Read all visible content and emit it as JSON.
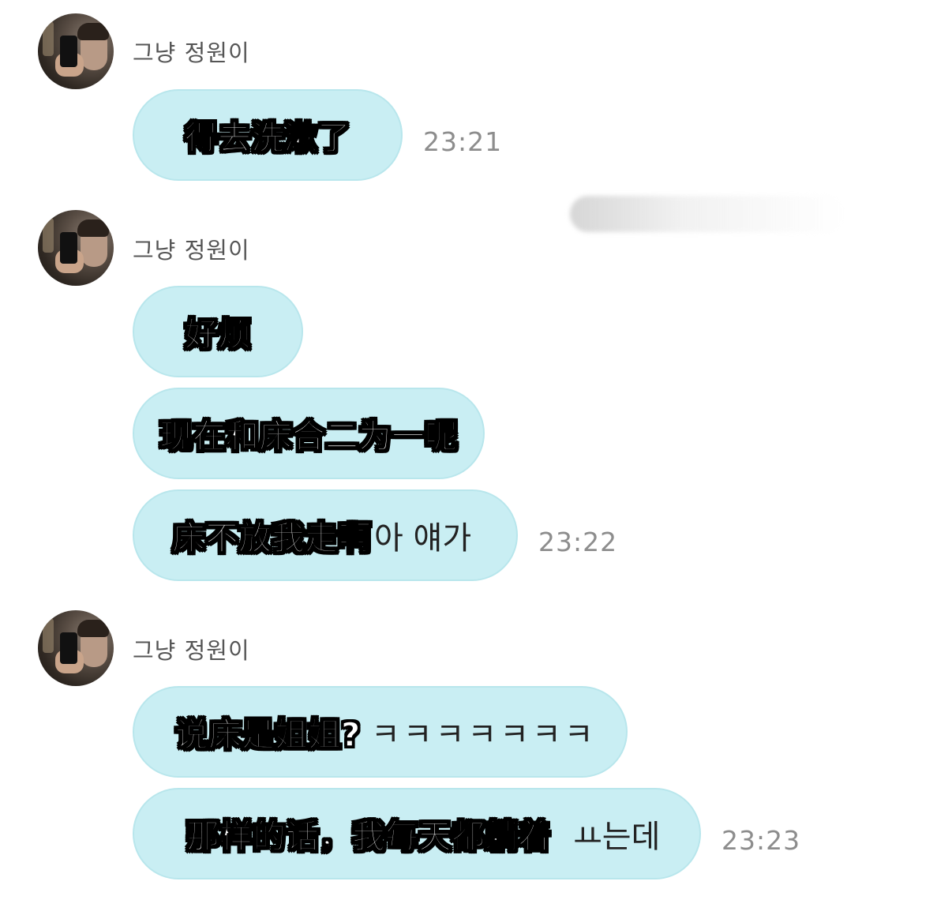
{
  "messages": [
    {
      "sender": "그냥 정원이",
      "bubbles": [
        {
          "ko": "",
          "cn": "得去洗漱了",
          "time": "23:21"
        }
      ]
    },
    {
      "sender": "그냥 정원이",
      "bubbles": [
        {
          "ko": "",
          "cn": "好烦",
          "time": ""
        },
        {
          "ko": "",
          "cn": "现在和床合二为一呢",
          "time": ""
        },
        {
          "ko": "아 얘가",
          "cn": "床不放我走啊",
          "time": "23:22"
        }
      ]
    },
    {
      "sender": "그냥 정원이",
      "bubbles": [
        {
          "ko": "ㅋㅋㅋㅋㅋㅋㅋ",
          "cn": "说床是姐姐?",
          "time": ""
        },
        {
          "ko": "ㅛ는데",
          "cn": "那样的话，我每天都躺着",
          "time": "23:23"
        }
      ]
    }
  ]
}
